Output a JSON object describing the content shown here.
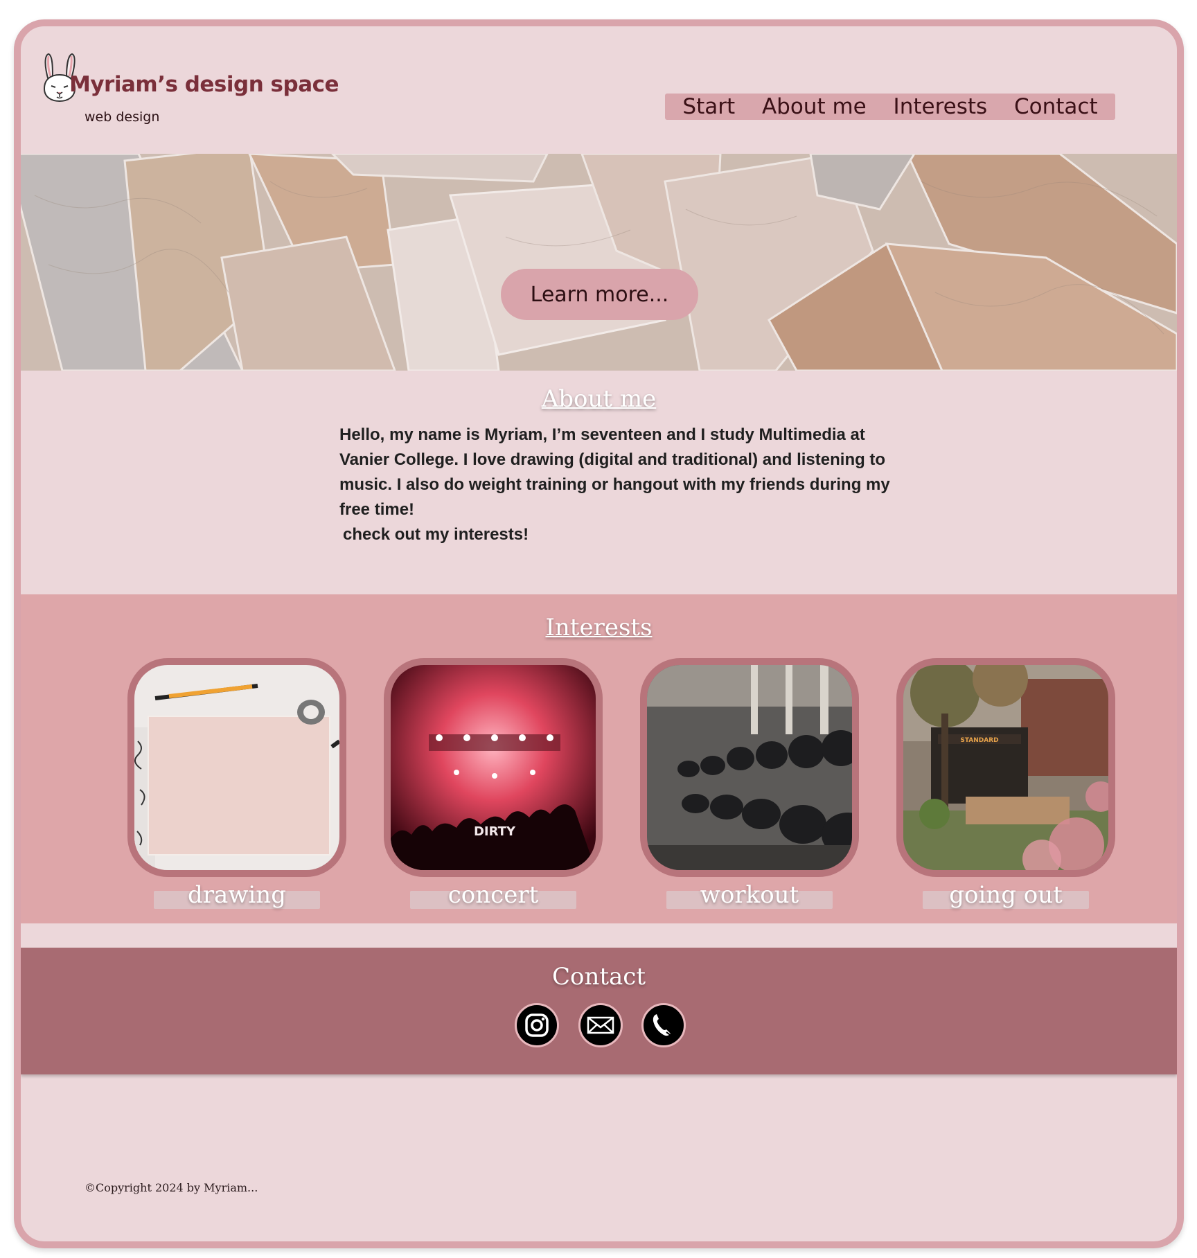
{
  "header": {
    "title": "Myriam’s design space",
    "subtitle": "web design",
    "logo_icon": "bunny-icon"
  },
  "nav": {
    "items": [
      "Start",
      "About me",
      "Interests",
      "Contact"
    ]
  },
  "hero": {
    "button_label": "Learn more..."
  },
  "about": {
    "title": "About me",
    "paragraph": "Hello, my name is Myriam, I’m seventeen and I study Multimedia at Vanier College. I love drawing (digital and traditional) and listening to music. I also do weight training or hangout with my friends during my free time!",
    "cta": "check out my interests!"
  },
  "interests": {
    "title": "Interests",
    "cards": [
      {
        "label": "drawing",
        "image": "drawing-desk-photo"
      },
      {
        "label": "concert",
        "image": "concert-stage-photo"
      },
      {
        "label": "workout",
        "image": "dumbbell-rack-photo"
      },
      {
        "label": "going out",
        "image": "street-cafe-photo"
      }
    ]
  },
  "contact": {
    "title": "Contact",
    "icons": [
      "instagram-icon",
      "mail-icon",
      "phone-icon"
    ]
  },
  "footer": {
    "copyright": "©Copyright 2024 by Myriam..."
  },
  "colors": {
    "background": "#ecd7da",
    "frame": "#d9a4ab",
    "brand_text": "#7a2f3a",
    "interests_bg": "#dea6a9",
    "contact_bg": "#a86b72"
  }
}
